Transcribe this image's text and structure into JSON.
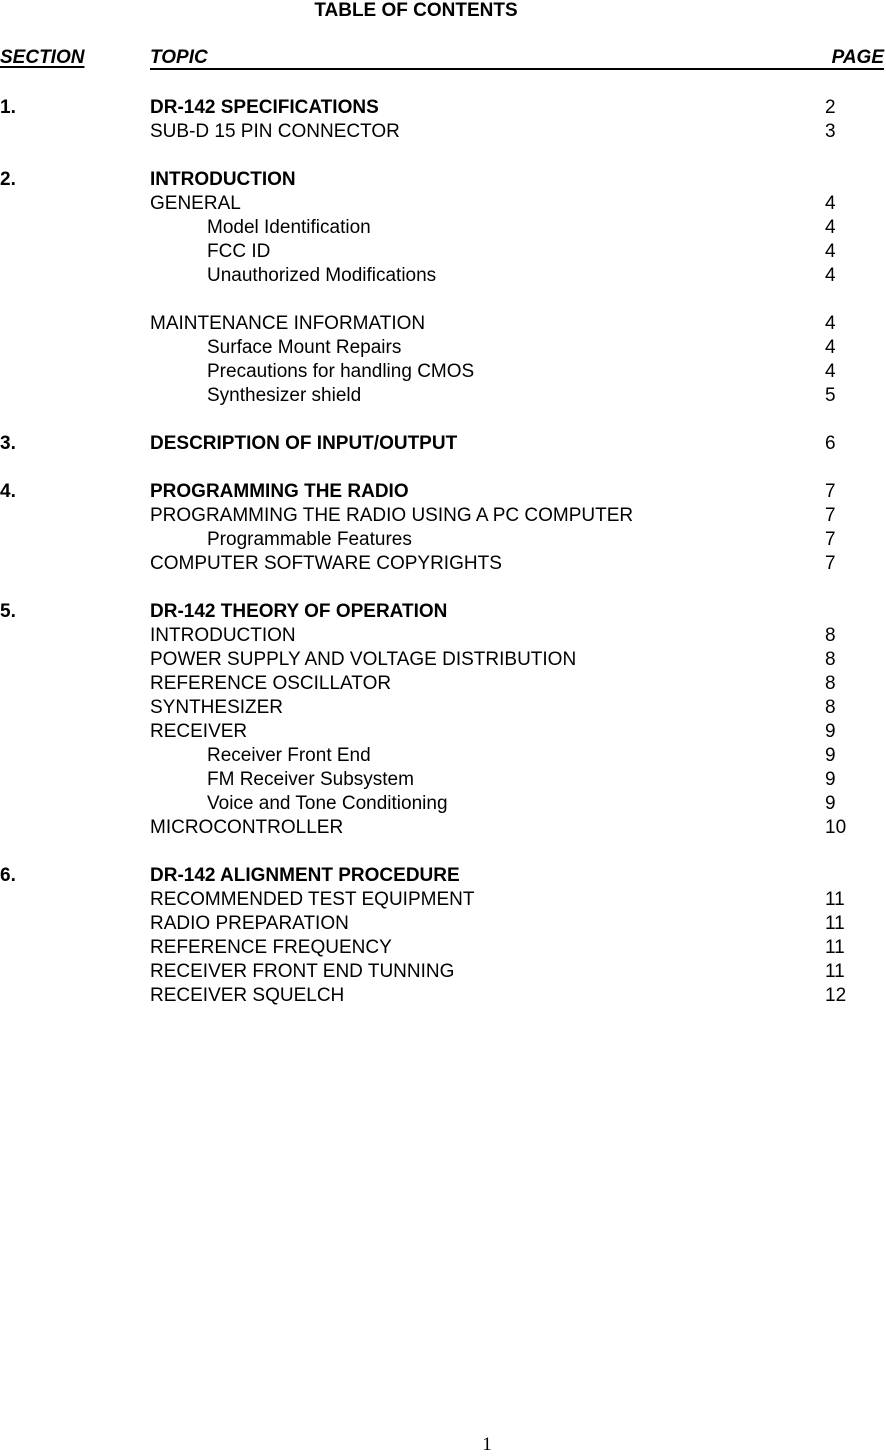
{
  "title": "TABLE OF CONTENTS",
  "headers": {
    "section": "SECTION",
    "topic": "TOPIC",
    "page": "PAGE"
  },
  "sections": [
    {
      "number": "1.",
      "title": "DR-142 SPECIFICATIONS",
      "page": "2",
      "entries": [
        {
          "level": 1,
          "text": "SUB-D 15 PIN CONNECTOR",
          "page": "3"
        }
      ]
    },
    {
      "number": "2.",
      "title": "INTRODUCTION",
      "page": "",
      "entries": [
        {
          "level": 1,
          "text": "GENERAL",
          "page": "4"
        },
        {
          "level": 2,
          "text": "Model Identification",
          "page": "4"
        },
        {
          "level": 2,
          "text": "FCC ID",
          "page": "4"
        },
        {
          "level": 2,
          "text": "Unauthorized Modifications",
          "page": "4"
        },
        {
          "level": 0,
          "text": "",
          "page": ""
        },
        {
          "level": 1,
          "text": "MAINTENANCE INFORMATION",
          "page": "4"
        },
        {
          "level": 2,
          "text": "Surface Mount Repairs",
          "page": "4"
        },
        {
          "level": 2,
          "text": "Precautions for handling CMOS",
          "page": "4"
        },
        {
          "level": 2,
          "text": "Synthesizer shield",
          "page": "5"
        }
      ]
    },
    {
      "number": "3.",
      "title": "DESCRIPTION OF INPUT/OUTPUT",
      "page": "6",
      "entries": []
    },
    {
      "number": "4.",
      "title": "PROGRAMMING THE RADIO",
      "page": "7",
      "entries": [
        {
          "level": 1,
          "text": "PROGRAMMING THE RADIO USING A PC COMPUTER",
          "page": "7"
        },
        {
          "level": 2,
          "text": "Programmable Features",
          "page": "7"
        },
        {
          "level": 1,
          "text": "COMPUTER SOFTWARE COPYRIGHTS",
          "page": "7"
        }
      ]
    },
    {
      "number": "5.",
      "title": "DR-142 THEORY OF OPERATION",
      "page": "",
      "entries": [
        {
          "level": 1,
          "text": "INTRODUCTION",
          "page": "8"
        },
        {
          "level": 1,
          "text": "POWER SUPPLY AND VOLTAGE DISTRIBUTION",
          "page": "8"
        },
        {
          "level": 1,
          "text": "REFERENCE OSCILLATOR",
          "page": "8"
        },
        {
          "level": 1,
          "text": "SYNTHESIZER",
          "page": "8"
        },
        {
          "level": 1,
          "text": "RECEIVER",
          "page": "9"
        },
        {
          "level": 2,
          "text": "Receiver Front End",
          "page": "9"
        },
        {
          "level": 2,
          "text": "FM Receiver Subsystem",
          "page": "9"
        },
        {
          "level": 2,
          "text": "Voice and Tone Conditioning",
          "page": "9"
        },
        {
          "level": 1,
          "text": "MICROCONTROLLER",
          "page": "10"
        }
      ]
    },
    {
      "number": "6.",
      "title": "DR-142 ALIGNMENT PROCEDURE",
      "page": "",
      "entries": [
        {
          "level": 1,
          "text": "RECOMMENDED TEST EQUIPMENT",
          "page": "11"
        },
        {
          "level": 1,
          "text": "RADIO PREPARATION",
          "page": "11"
        },
        {
          "level": 1,
          "text": "REFERENCE FREQUENCY",
          "page": "11"
        },
        {
          "level": 1,
          "text": "RECEIVER FRONT END TUNNING",
          "page": "11"
        },
        {
          "level": 1,
          "text": "RECEIVER SQUELCH",
          "page": "12"
        }
      ]
    }
  ],
  "footer": {
    "page_number": "1"
  }
}
